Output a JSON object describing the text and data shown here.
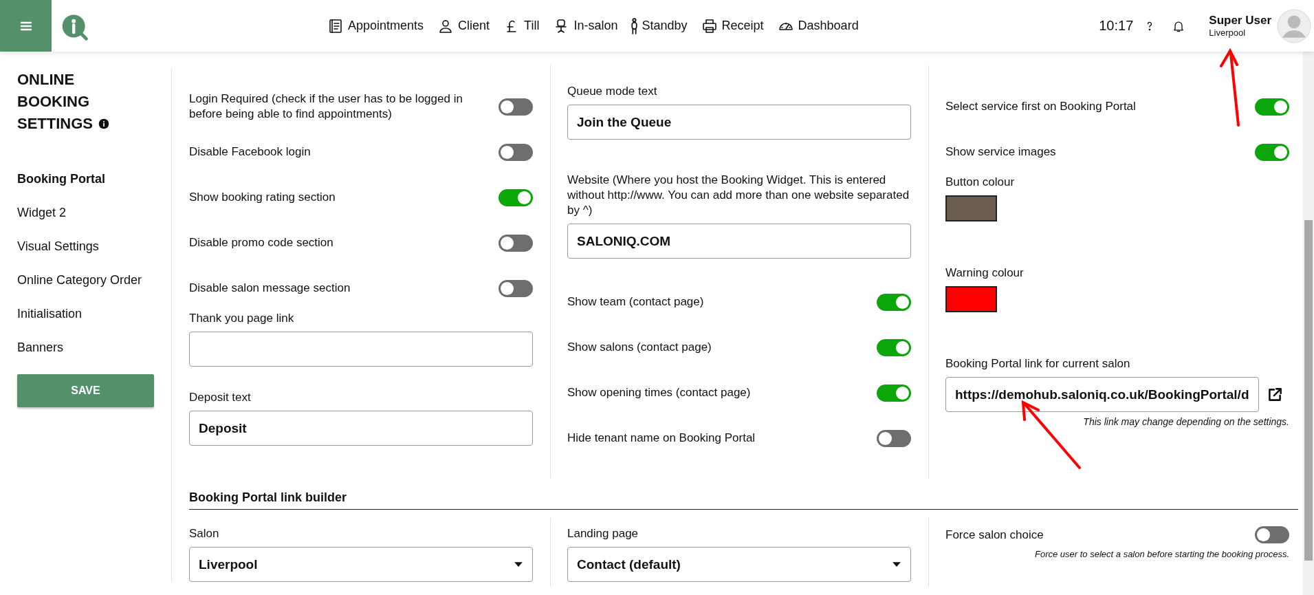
{
  "top_bar": {
    "nav": [
      {
        "label": "Appointments"
      },
      {
        "label": "Client"
      },
      {
        "label": "Till"
      },
      {
        "label": "In-salon"
      },
      {
        "label": "Standby"
      },
      {
        "label": "Receipt"
      },
      {
        "label": "Dashboard"
      }
    ],
    "time": "10:17",
    "user": {
      "name": "Super User",
      "location": "Liverpool"
    }
  },
  "sidebar": {
    "title": "ONLINE BOOKING SETTINGS",
    "items": [
      {
        "label": "Booking Portal",
        "selected": true
      },
      {
        "label": "Widget 2",
        "selected": false
      },
      {
        "label": "Visual Settings",
        "selected": false
      },
      {
        "label": "Online Category Order",
        "selected": false
      },
      {
        "label": "Initialisation",
        "selected": false
      },
      {
        "label": "Banners",
        "selected": false
      }
    ],
    "save_button": "SAVE"
  },
  "columns": [
    {
      "items": [
        {
          "kind": "toggle",
          "label": "Login Required (check if the user has to be logged in before being able to find appointments)",
          "on": false
        },
        {
          "kind": "toggle",
          "label": "Disable Facebook login",
          "on": false
        },
        {
          "kind": "toggle",
          "label": "Show booking rating section",
          "on": true
        },
        {
          "kind": "toggle",
          "label": "Disable promo code section",
          "on": false
        },
        {
          "kind": "toggle",
          "label": "Disable salon message section",
          "on": false
        },
        {
          "kind": "text",
          "label": "Thank you page link"
        },
        {
          "kind": "text",
          "label": "Deposit text",
          "value": "Deposit"
        }
      ]
    },
    {
      "items": [
        {
          "kind": "text",
          "label": "Queue mode text",
          "value": "Join the Queue"
        },
        {
          "kind": "text",
          "label": "Website (Where you host the Booking Widget. This is entered without http://www. You can add more than one website separated by ^)",
          "value": "SALONIQ.COM"
        },
        {
          "kind": "toggle",
          "label": "Show team (contact page)",
          "on": true
        },
        {
          "kind": "toggle",
          "label": "Show salons (contact page)",
          "on": true
        },
        {
          "kind": "toggle",
          "label": "Show opening times (contact page)",
          "on": true
        },
        {
          "kind": "toggle",
          "label": "Hide tenant name on Booking Portal",
          "on": false
        }
      ]
    },
    {
      "items": [
        {
          "kind": "toggle",
          "label": "Select service first on Booking Portal",
          "on": true
        },
        {
          "kind": "toggle",
          "label": "Show service images",
          "on": true
        },
        {
          "kind": "swatch",
          "label": "Button colour",
          "color": "#6b5e4f"
        },
        {
          "kind": "swatch",
          "label": "Warning colour",
          "color": "#ff0000"
        },
        {
          "kind": "link",
          "label": "Booking Portal link for current salon",
          "value": "https://demohub.saloniq.co.uk/BookingPortal/d",
          "note": "This link may change depending on the settings."
        }
      ]
    }
  ],
  "link_builder": {
    "title": "Booking Portal link builder",
    "fields": [
      {
        "kind": "select",
        "label": "Salon",
        "value": "Liverpool"
      },
      {
        "kind": "select",
        "label": "Landing page",
        "value": "Contact (default)"
      },
      {
        "kind": "toggle",
        "label": "Force salon choice",
        "on": false,
        "note": "Force user to select a salon before starting the booking process."
      }
    ]
  }
}
